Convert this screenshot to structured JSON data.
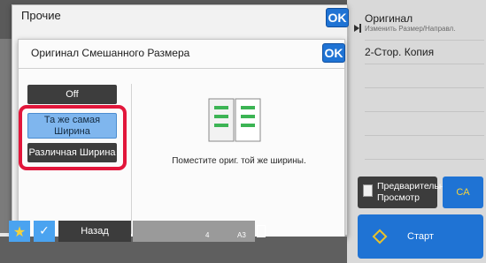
{
  "outer_dialog": {
    "title": "Прочие",
    "ok_label": "OK"
  },
  "inner_dialog": {
    "title": "Оригинал Смешанного Размера",
    "ok_label": "OK",
    "options": [
      {
        "label": "Off",
        "selected": false
      },
      {
        "label": "Та же самая Ширина",
        "selected": true
      },
      {
        "label": "Различная Ширина",
        "selected": false
      }
    ],
    "info_text": "Поместите ориг. той же ширины.",
    "icon": "document-same-width-icon"
  },
  "right_panel": {
    "original_title": "Оригинал",
    "original_sub": "Изменить Размер/Направл.",
    "duplex_label": "2-Стор. Копия"
  },
  "actions": {
    "preview_label": "Предварительный Просмотр",
    "ca_label": "CA",
    "start_label": "Старт"
  },
  "bottom_bar": {
    "back_label": "Назад",
    "tray_number": "4",
    "paper_size": "A3"
  },
  "colors": {
    "accent_blue": "#1f73d4",
    "selected_option": "#7fb6ee",
    "highlight_red": "#e2163b",
    "dark_button": "#3d3d3d"
  }
}
